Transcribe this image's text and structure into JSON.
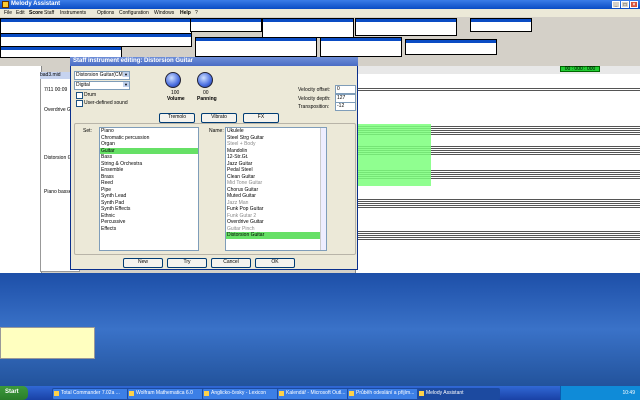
{
  "app": {
    "title": "Melody Assistant",
    "menu": [
      "File",
      "Edit",
      "Score",
      "Staff",
      "Instruments",
      "Options",
      "Configuration",
      "Windows",
      "Help",
      "?"
    ]
  },
  "score_header": {
    "position_label": "00 : 000 : 000"
  },
  "bg_window": {
    "title": "bad3.mid",
    "time": "7/11  00:09",
    "labels": [
      "Overdrive Gu",
      "Distorsion Gu",
      "Piano basse"
    ]
  },
  "dialog": {
    "title": "Staff instrument editing: Distorsion Guitar",
    "instrument_combo": "Distorsion Guitar(CM)",
    "source_combo": "Digital",
    "drum_label": "Drum",
    "user_sound_label": "User-defined sound",
    "volume": {
      "value": "100",
      "label": "Volume"
    },
    "panning": {
      "value": "00",
      "label": "Panning"
    },
    "velocity_offset_label": "Velocity offset:",
    "velocity_offset_value": "0",
    "velocity_depth_label": "Velocity depth:",
    "velocity_depth_value": "127",
    "transposition_label": "Transposition:",
    "transposition_value": "-12",
    "tremolo": "Tremolo",
    "vibrato": "Vibrato",
    "fx": "FX",
    "set_label": "Set:",
    "name_label": "Name:",
    "sets": [
      "Piano",
      "Chromatic percussion",
      "Organ",
      "Guitar",
      "Bass",
      "String & Orchestra",
      "Ensemble",
      "Brass",
      "Reed",
      "Pipe",
      "Synth Lead",
      "Synth Pad",
      "Synth Effects",
      "Ethnic",
      "Percussive",
      "Effects"
    ],
    "names": [
      "Ukulele",
      "Steel Strg Guitar",
      "Steel + Body",
      "Mandolin",
      "12-Str.Gt.",
      "Jazz Guitar",
      "Pedal Steel",
      "Clean Guitar",
      "Mid Tone Guitar",
      "Chorus Guitar",
      "Muted Guitar",
      "Jazz Man",
      "Funk Pop Guitar",
      "Funk Gutar 2",
      "Overdrive Guitar",
      "Guitar Pinch",
      "Distorsion Guitar"
    ],
    "buttons": {
      "new": "New",
      "try": "Try",
      "cancel": "Cancel",
      "ok": "OK"
    }
  },
  "taskbar": {
    "start": "Start",
    "tasks": [
      "Total Commander 7.02a ...",
      "Wolfram Mathematica 6.0",
      "Anglicko-česky - Lexicon",
      "Kalendář - Microsoft Outl...",
      "Průběh odeslání a přijím...",
      "Melody Assistant"
    ],
    "clock": "10:49"
  }
}
